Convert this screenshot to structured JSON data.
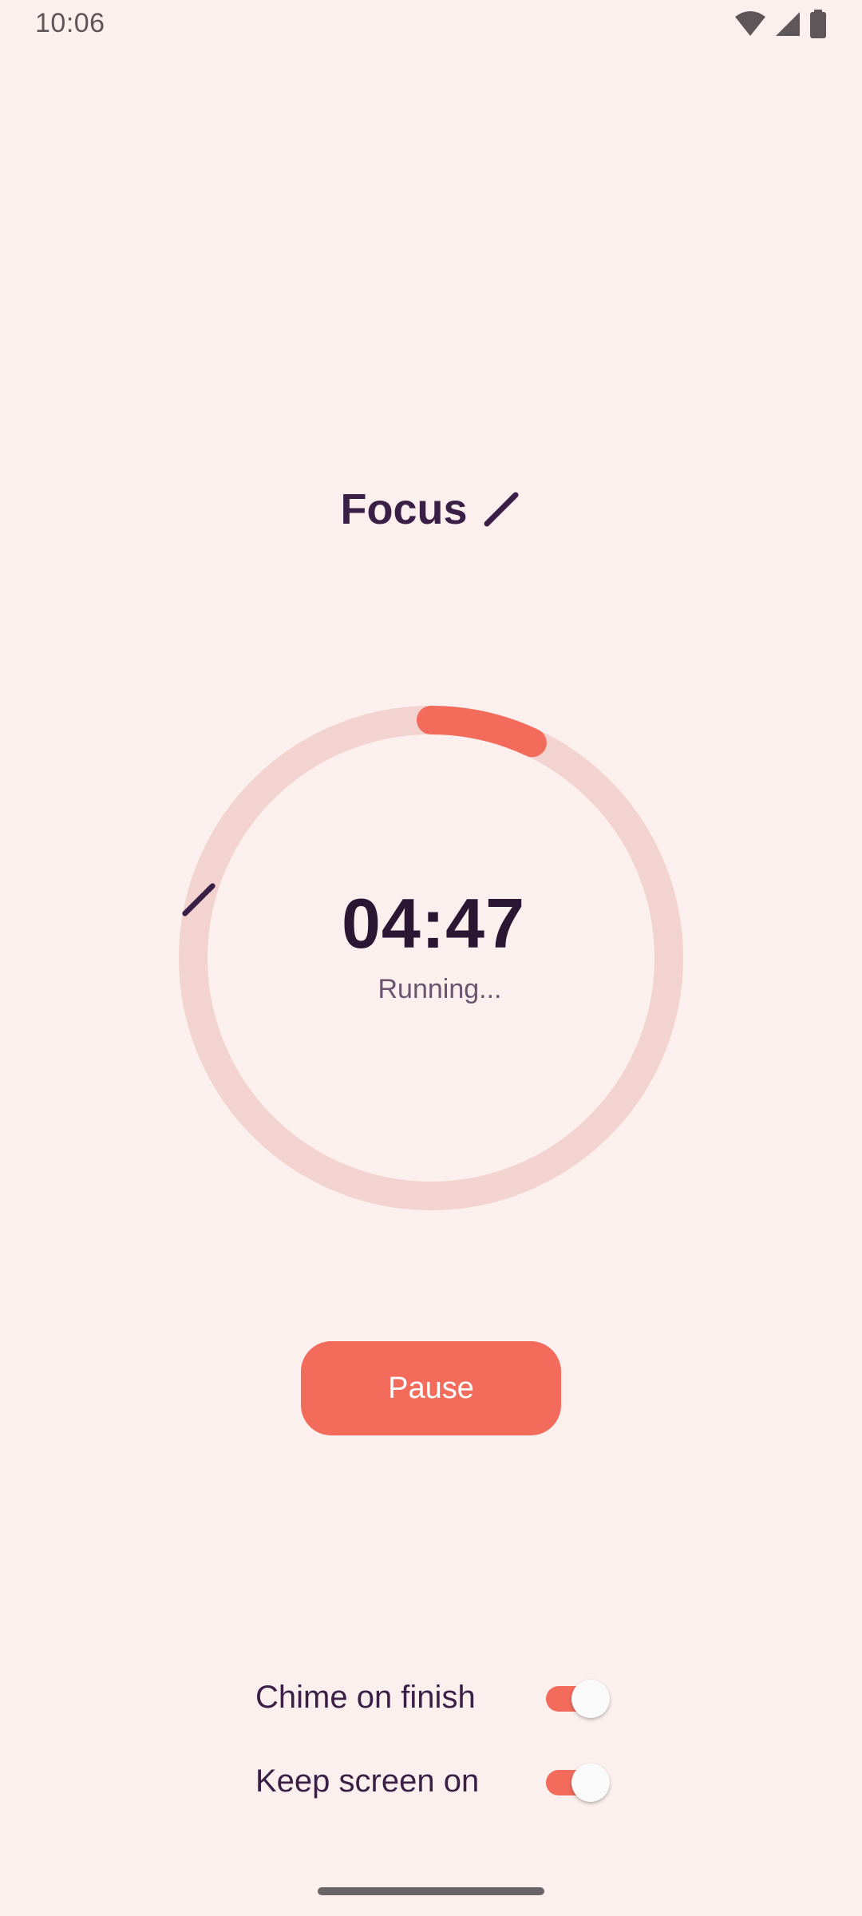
{
  "status_bar": {
    "time": "10:06",
    "icons": [
      "wifi-icon",
      "signal-icon",
      "battery-icon"
    ]
  },
  "session": {
    "title": "Focus",
    "edit_icon": "pencil-icon"
  },
  "timer": {
    "remaining": "04:47",
    "status": "Running...",
    "progress_fraction": 0.07
  },
  "controls": {
    "pause_label": "Pause"
  },
  "settings": [
    {
      "label": "Chime on finish",
      "enabled": true
    },
    {
      "label": "Keep screen on",
      "enabled": true
    }
  ],
  "colors": {
    "background": "#fcf0ee",
    "accent": "#f26b5b",
    "ring_track": "#f3d3cf",
    "text_primary": "#3a1f47"
  }
}
